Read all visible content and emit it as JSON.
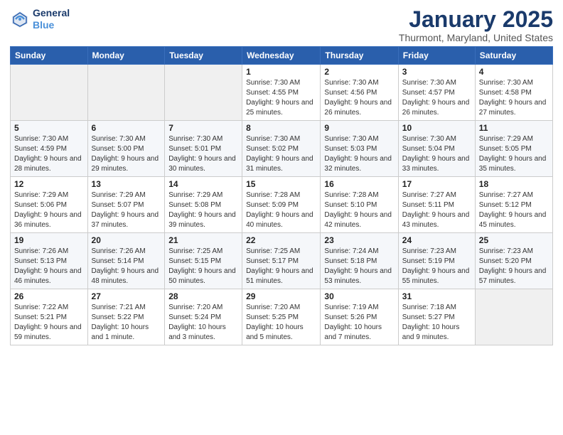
{
  "header": {
    "logo_line1": "General",
    "logo_line2": "Blue",
    "month": "January 2025",
    "location": "Thurmont, Maryland, United States"
  },
  "weekdays": [
    "Sunday",
    "Monday",
    "Tuesday",
    "Wednesday",
    "Thursday",
    "Friday",
    "Saturday"
  ],
  "weeks": [
    [
      {
        "day": "",
        "sunrise": "",
        "sunset": "",
        "daylight": ""
      },
      {
        "day": "",
        "sunrise": "",
        "sunset": "",
        "daylight": ""
      },
      {
        "day": "",
        "sunrise": "",
        "sunset": "",
        "daylight": ""
      },
      {
        "day": "1",
        "sunrise": "Sunrise: 7:30 AM",
        "sunset": "Sunset: 4:55 PM",
        "daylight": "Daylight: 9 hours and 25 minutes."
      },
      {
        "day": "2",
        "sunrise": "Sunrise: 7:30 AM",
        "sunset": "Sunset: 4:56 PM",
        "daylight": "Daylight: 9 hours and 26 minutes."
      },
      {
        "day": "3",
        "sunrise": "Sunrise: 7:30 AM",
        "sunset": "Sunset: 4:57 PM",
        "daylight": "Daylight: 9 hours and 26 minutes."
      },
      {
        "day": "4",
        "sunrise": "Sunrise: 7:30 AM",
        "sunset": "Sunset: 4:58 PM",
        "daylight": "Daylight: 9 hours and 27 minutes."
      }
    ],
    [
      {
        "day": "5",
        "sunrise": "Sunrise: 7:30 AM",
        "sunset": "Sunset: 4:59 PM",
        "daylight": "Daylight: 9 hours and 28 minutes."
      },
      {
        "day": "6",
        "sunrise": "Sunrise: 7:30 AM",
        "sunset": "Sunset: 5:00 PM",
        "daylight": "Daylight: 9 hours and 29 minutes."
      },
      {
        "day": "7",
        "sunrise": "Sunrise: 7:30 AM",
        "sunset": "Sunset: 5:01 PM",
        "daylight": "Daylight: 9 hours and 30 minutes."
      },
      {
        "day": "8",
        "sunrise": "Sunrise: 7:30 AM",
        "sunset": "Sunset: 5:02 PM",
        "daylight": "Daylight: 9 hours and 31 minutes."
      },
      {
        "day": "9",
        "sunrise": "Sunrise: 7:30 AM",
        "sunset": "Sunset: 5:03 PM",
        "daylight": "Daylight: 9 hours and 32 minutes."
      },
      {
        "day": "10",
        "sunrise": "Sunrise: 7:30 AM",
        "sunset": "Sunset: 5:04 PM",
        "daylight": "Daylight: 9 hours and 33 minutes."
      },
      {
        "day": "11",
        "sunrise": "Sunrise: 7:29 AM",
        "sunset": "Sunset: 5:05 PM",
        "daylight": "Daylight: 9 hours and 35 minutes."
      }
    ],
    [
      {
        "day": "12",
        "sunrise": "Sunrise: 7:29 AM",
        "sunset": "Sunset: 5:06 PM",
        "daylight": "Daylight: 9 hours and 36 minutes."
      },
      {
        "day": "13",
        "sunrise": "Sunrise: 7:29 AM",
        "sunset": "Sunset: 5:07 PM",
        "daylight": "Daylight: 9 hours and 37 minutes."
      },
      {
        "day": "14",
        "sunrise": "Sunrise: 7:29 AM",
        "sunset": "Sunset: 5:08 PM",
        "daylight": "Daylight: 9 hours and 39 minutes."
      },
      {
        "day": "15",
        "sunrise": "Sunrise: 7:28 AM",
        "sunset": "Sunset: 5:09 PM",
        "daylight": "Daylight: 9 hours and 40 minutes."
      },
      {
        "day": "16",
        "sunrise": "Sunrise: 7:28 AM",
        "sunset": "Sunset: 5:10 PM",
        "daylight": "Daylight: 9 hours and 42 minutes."
      },
      {
        "day": "17",
        "sunrise": "Sunrise: 7:27 AM",
        "sunset": "Sunset: 5:11 PM",
        "daylight": "Daylight: 9 hours and 43 minutes."
      },
      {
        "day": "18",
        "sunrise": "Sunrise: 7:27 AM",
        "sunset": "Sunset: 5:12 PM",
        "daylight": "Daylight: 9 hours and 45 minutes."
      }
    ],
    [
      {
        "day": "19",
        "sunrise": "Sunrise: 7:26 AM",
        "sunset": "Sunset: 5:13 PM",
        "daylight": "Daylight: 9 hours and 46 minutes."
      },
      {
        "day": "20",
        "sunrise": "Sunrise: 7:26 AM",
        "sunset": "Sunset: 5:14 PM",
        "daylight": "Daylight: 9 hours and 48 minutes."
      },
      {
        "day": "21",
        "sunrise": "Sunrise: 7:25 AM",
        "sunset": "Sunset: 5:15 PM",
        "daylight": "Daylight: 9 hours and 50 minutes."
      },
      {
        "day": "22",
        "sunrise": "Sunrise: 7:25 AM",
        "sunset": "Sunset: 5:17 PM",
        "daylight": "Daylight: 9 hours and 51 minutes."
      },
      {
        "day": "23",
        "sunrise": "Sunrise: 7:24 AM",
        "sunset": "Sunset: 5:18 PM",
        "daylight": "Daylight: 9 hours and 53 minutes."
      },
      {
        "day": "24",
        "sunrise": "Sunrise: 7:23 AM",
        "sunset": "Sunset: 5:19 PM",
        "daylight": "Daylight: 9 hours and 55 minutes."
      },
      {
        "day": "25",
        "sunrise": "Sunrise: 7:23 AM",
        "sunset": "Sunset: 5:20 PM",
        "daylight": "Daylight: 9 hours and 57 minutes."
      }
    ],
    [
      {
        "day": "26",
        "sunrise": "Sunrise: 7:22 AM",
        "sunset": "Sunset: 5:21 PM",
        "daylight": "Daylight: 9 hours and 59 minutes."
      },
      {
        "day": "27",
        "sunrise": "Sunrise: 7:21 AM",
        "sunset": "Sunset: 5:22 PM",
        "daylight": "Daylight: 10 hours and 1 minute."
      },
      {
        "day": "28",
        "sunrise": "Sunrise: 7:20 AM",
        "sunset": "Sunset: 5:24 PM",
        "daylight": "Daylight: 10 hours and 3 minutes."
      },
      {
        "day": "29",
        "sunrise": "Sunrise: 7:20 AM",
        "sunset": "Sunset: 5:25 PM",
        "daylight": "Daylight: 10 hours and 5 minutes."
      },
      {
        "day": "30",
        "sunrise": "Sunrise: 7:19 AM",
        "sunset": "Sunset: 5:26 PM",
        "daylight": "Daylight: 10 hours and 7 minutes."
      },
      {
        "day": "31",
        "sunrise": "Sunrise: 7:18 AM",
        "sunset": "Sunset: 5:27 PM",
        "daylight": "Daylight: 10 hours and 9 minutes."
      },
      {
        "day": "",
        "sunrise": "",
        "sunset": "",
        "daylight": ""
      }
    ]
  ]
}
